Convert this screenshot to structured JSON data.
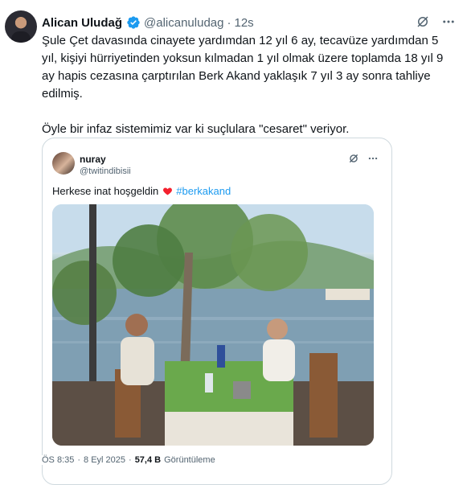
{
  "author": {
    "name": "Alican Uludağ",
    "handle": "@alicanuludag",
    "separator": "·",
    "time": "12s"
  },
  "tweet": {
    "text": "Şule Çet davasında cinayete yardımdan 12 yıl 6 ay, tecavüze yardımdan 5 yıl, kişiyi hürriyetinden yoksun kılmadan 1 yıl olmak üzere toplamda 18 yıl 9 ay hapis cezasına çarptırılan Berk Akand yaklaşık 7 yıl 3 ay sonra tahliye edilmiş.\n\nÖyle bir infaz sistemimiz var ki suçlulara \"cesaret\" veriyor."
  },
  "quote": {
    "name": "nuray",
    "handle": "@twitindibisii",
    "text_before": "Herkese inat hoşgeldin",
    "heart": "❤",
    "hashtag": "#berkakand"
  },
  "footer": {
    "time": "ÖS 8:35",
    "separator": "·",
    "date": "8 Eyl 2025",
    "views": "57,4 B",
    "views_label": "Görüntüleme"
  },
  "colors": {
    "text": "#0f1419",
    "secondary": "#536471",
    "link": "#1d9bf0",
    "verified": "#1d9bf0",
    "heart": "#f4212e",
    "border": "#cfd9de"
  },
  "icons": {
    "verified": "verified-badge-icon",
    "grok": "grok-icon",
    "more": "more-options-icon",
    "heart": "red-heart-icon"
  }
}
